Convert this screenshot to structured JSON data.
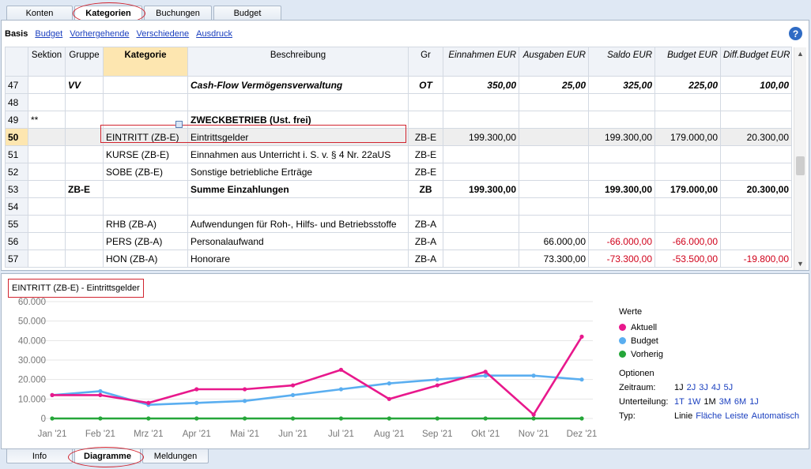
{
  "top_tabs": [
    "Konten",
    "Kategorien",
    "Buchungen",
    "Budget"
  ],
  "views": {
    "current": "Basis",
    "links": [
      "Budget",
      "Vorhergehende",
      "Verschiedene",
      "Ausdruck"
    ]
  },
  "help": "?",
  "columns": {
    "row": "",
    "sektion": "Sektion",
    "gruppe": "Gruppe",
    "kategorie": "Kategorie",
    "beschreibung": "Beschreibung",
    "gr": "Gr",
    "einnahmen": "Einnahmen EUR",
    "ausgaben": "Ausgaben EUR",
    "saldo": "Saldo EUR",
    "budget": "Budget EUR",
    "diff": "Diff.Budget EUR"
  },
  "rows": [
    {
      "n": "47",
      "sektion": "",
      "gruppe": "VV",
      "kategorie": "",
      "beschreibung": "Cash-Flow Vermögensverwaltung",
      "gr": "OT",
      "einnahmen": "350,00",
      "ausgaben": "25,00",
      "saldo": "325,00",
      "budget": "225,00",
      "diff": "100,00"
    },
    {
      "n": "48",
      "sektion": "",
      "gruppe": "",
      "kategorie": "",
      "beschreibung": "",
      "gr": "",
      "einnahmen": "",
      "ausgaben": "",
      "saldo": "",
      "budget": "",
      "diff": ""
    },
    {
      "n": "49",
      "sektion": "**",
      "gruppe": "",
      "kategorie": "",
      "beschreibung": "ZWECKBETRIEB (Ust. frei)",
      "gr": "",
      "einnahmen": "",
      "ausgaben": "",
      "saldo": "",
      "budget": "",
      "diff": ""
    },
    {
      "n": "50",
      "sektion": "",
      "gruppe": "",
      "kategorie": "EINTRITT (ZB-E)",
      "beschreibung": "Eintrittsgelder",
      "gr": "ZB-E",
      "einnahmen": "199.300,00",
      "ausgaben": "",
      "saldo": "199.300,00",
      "budget": "179.000,00",
      "diff": "20.300,00"
    },
    {
      "n": "51",
      "sektion": "",
      "gruppe": "",
      "kategorie": "KURSE (ZB-E)",
      "beschreibung": "Einnahmen aus Unterricht i. S. v. § 4 Nr. 22aUS",
      "gr": "ZB-E",
      "einnahmen": "",
      "ausgaben": "",
      "saldo": "",
      "budget": "",
      "diff": ""
    },
    {
      "n": "52",
      "sektion": "",
      "gruppe": "",
      "kategorie": "SOBE (ZB-E)",
      "beschreibung": "Sonstige betriebliche Erträge",
      "gr": "ZB-E",
      "einnahmen": "",
      "ausgaben": "",
      "saldo": "",
      "budget": "",
      "diff": ""
    },
    {
      "n": "53",
      "sektion": "",
      "gruppe": "ZB-E",
      "kategorie": "",
      "beschreibung": "Summe Einzahlungen",
      "gr": "ZB",
      "einnahmen": "199.300,00",
      "ausgaben": "",
      "saldo": "199.300,00",
      "budget": "179.000,00",
      "diff": "20.300,00"
    },
    {
      "n": "54",
      "sektion": "",
      "gruppe": "",
      "kategorie": "",
      "beschreibung": "",
      "gr": "",
      "einnahmen": "",
      "ausgaben": "",
      "saldo": "",
      "budget": "",
      "diff": ""
    },
    {
      "n": "55",
      "sektion": "",
      "gruppe": "",
      "kategorie": "RHB (ZB-A)",
      "beschreibung": "Aufwendungen für Roh-, Hilfs- und Betriebsstoffe",
      "gr": "ZB-A",
      "einnahmen": "",
      "ausgaben": "",
      "saldo": "",
      "budget": "",
      "diff": ""
    },
    {
      "n": "56",
      "sektion": "",
      "gruppe": "",
      "kategorie": "PERS (ZB-A)",
      "beschreibung": "Personalaufwand",
      "gr": "ZB-A",
      "einnahmen": "",
      "ausgaben": "66.000,00",
      "saldo": "-66.000,00",
      "budget": "-66.000,00",
      "diff": ""
    },
    {
      "n": "57",
      "sektion": "",
      "gruppe": "",
      "kategorie": "HON (ZB-A)",
      "beschreibung": "Honorare",
      "gr": "ZB-A",
      "einnahmen": "",
      "ausgaben": "73.300,00",
      "saldo": "-73.300,00",
      "budget": "-53.500,00",
      "diff": "-19.800,00"
    }
  ],
  "chart_title": "EINTRITT (ZB-E) - Eintrittsgelder",
  "chart_data": {
    "type": "line",
    "categories": [
      "Jan '21",
      "Feb '21",
      "Mrz '21",
      "Apr '21",
      "Mai '21",
      "Jun '21",
      "Jul '21",
      "Aug '21",
      "Sep '21",
      "Okt '21",
      "Nov '21",
      "Dez '21"
    ],
    "y_ticks": [
      "0",
      "10.000",
      "20.000",
      "30.000",
      "40.000",
      "50.000",
      "60.000"
    ],
    "ylim": [
      0,
      60000
    ],
    "series": [
      {
        "name": "Aktuell",
        "color": "#e8188c",
        "values": [
          12000,
          12000,
          8000,
          15000,
          15000,
          17000,
          25000,
          10000,
          17000,
          24000,
          2000,
          42000
        ]
      },
      {
        "name": "Budget",
        "color": "#5aaef0",
        "values": [
          12000,
          14000,
          7000,
          8000,
          9000,
          12000,
          15000,
          18000,
          20000,
          22000,
          22000,
          20000
        ]
      },
      {
        "name": "Vorherig",
        "color": "#25a639",
        "values": [
          0,
          0,
          0,
          0,
          0,
          0,
          0,
          0,
          0,
          0,
          0,
          0
        ]
      }
    ],
    "grid": true,
    "legend_position": "right"
  },
  "legend": {
    "heading": "Werte",
    "items": [
      "Aktuell",
      "Budget",
      "Vorherig"
    ]
  },
  "options": {
    "heading": "Optionen",
    "zeitraum": {
      "label": "Zeitraum:",
      "opts": [
        "1J",
        "2J",
        "3J",
        "4J",
        "5J"
      ]
    },
    "unterteilung": {
      "label": "Unterteilung:",
      "opts": [
        "1T",
        "1W",
        "1M",
        "3M",
        "6M",
        "1J"
      ]
    },
    "typ": {
      "label": "Typ:",
      "opts": [
        "Linie",
        "Fläche",
        "Leiste",
        "Automatisch"
      ]
    }
  },
  "bottom_tabs": [
    "Info",
    "Diagramme",
    "Meldungen"
  ]
}
